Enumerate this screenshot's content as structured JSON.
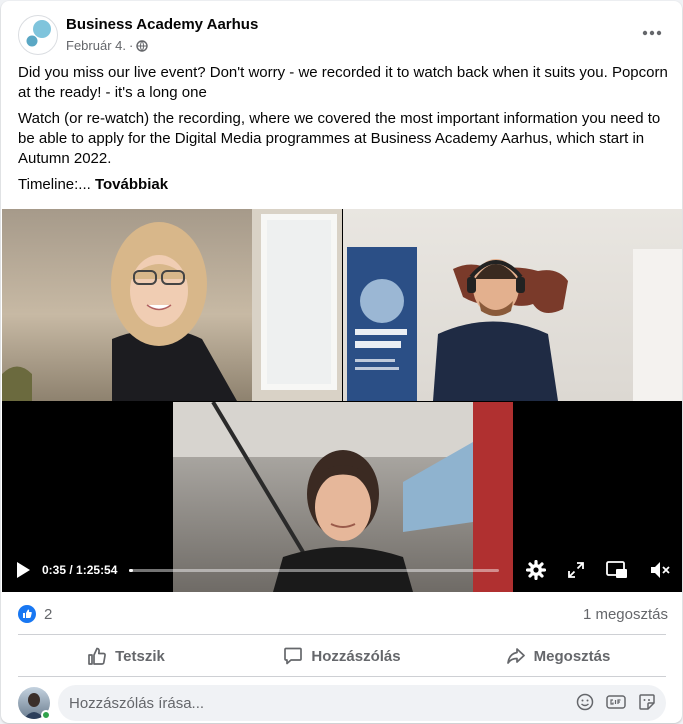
{
  "post": {
    "page_name": "Business Academy Aarhus",
    "date": "Február 4.",
    "separator": "·",
    "paragraph_1": "Did you miss our live event? Don't worry - we recorded it to watch back when it suits you. Popcorn at the ready! - it's a long one",
    "paragraph_2": "Watch (or re-watch) the recording, where we covered the most important information you need to be able to apply for the Digital Media programmes at Business Academy Aarhus, which start in Autumn 2022.",
    "timeline_prefix": "Timeline:... ",
    "see_more": "Továbbiak"
  },
  "video": {
    "current_time": "0:35",
    "duration": "1:25:54",
    "time_separator": " / ",
    "progress_fraction": 0.007,
    "icons": [
      "play-icon",
      "settings-gear-icon",
      "fullscreen-icon",
      "picture-in-picture-icon",
      "mute-icon"
    ]
  },
  "stats": {
    "like_count": "2",
    "shares": "1 megosztás"
  },
  "actions": {
    "like": "Tetszik",
    "comment": "Hozzászólás",
    "share": "Megosztás"
  },
  "comment": {
    "placeholder": "Hozzászólás írása..."
  },
  "colors": {
    "like_blue": "#1877f2",
    "secondary_text": "#65676b",
    "online_green": "#31a24c",
    "logo_teal": "#5aa7c4"
  }
}
